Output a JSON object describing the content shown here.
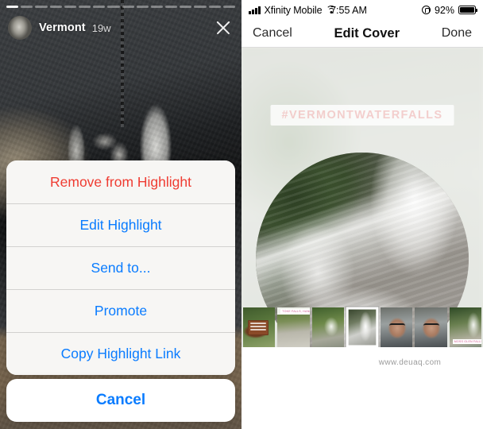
{
  "left_panel": {
    "progress": {
      "total_segments": 16,
      "active_index": 0
    },
    "story_header": {
      "username": "Vermont",
      "timestamp": "19w",
      "avatar_name": "story-avatar",
      "close_icon": "close-icon"
    },
    "action_sheet": {
      "items": [
        {
          "label": "Remove from Highlight",
          "style": "destructive"
        },
        {
          "label": "Edit Highlight",
          "style": "default"
        },
        {
          "label": "Send to...",
          "style": "default"
        },
        {
          "label": "Promote",
          "style": "default"
        },
        {
          "label": "Copy Highlight Link",
          "style": "default"
        }
      ],
      "cancel_label": "Cancel"
    },
    "colors": {
      "destructive": "#ef3c32",
      "tint": "#0a7cff",
      "sheet_bg": "#f7f6f4"
    }
  },
  "right_panel": {
    "status_bar": {
      "carrier": "Xfinity Mobile",
      "time": "7:55 AM",
      "battery_percent": "92%",
      "signal_icon": "signal-bars-icon",
      "wifi_icon": "wifi-icon",
      "rotation_lock_icon": "rotation-lock-icon",
      "battery_icon": "battery-icon"
    },
    "nav_bar": {
      "cancel_label": "Cancel",
      "title": "Edit Cover",
      "done_label": "Done"
    },
    "cover": {
      "hashtag": "#VERMONTWATERFALLS",
      "photo_name": "waterfall-cover-photo"
    },
    "thumbnails": [
      {
        "id": "thumb-1",
        "class": "th1",
        "selected": false,
        "tag": ""
      },
      {
        "id": "thumb-2",
        "class": "th2",
        "selected": false,
        "tag": "TOKE FALLS, HANCOCK, VT"
      },
      {
        "id": "thumb-3",
        "class": "th3",
        "selected": false,
        "tag": ""
      },
      {
        "id": "thumb-4",
        "class": "th4",
        "selected": true,
        "tag": ""
      },
      {
        "id": "thumb-5",
        "class": "th5",
        "selected": false,
        "tag": ""
      },
      {
        "id": "thumb-6",
        "class": "th6",
        "selected": false,
        "tag": ""
      },
      {
        "id": "thumb-7",
        "class": "th7",
        "selected": false,
        "tag": "MOSS GLEN FALLS"
      }
    ],
    "watermark": "www.deuaq.com"
  }
}
